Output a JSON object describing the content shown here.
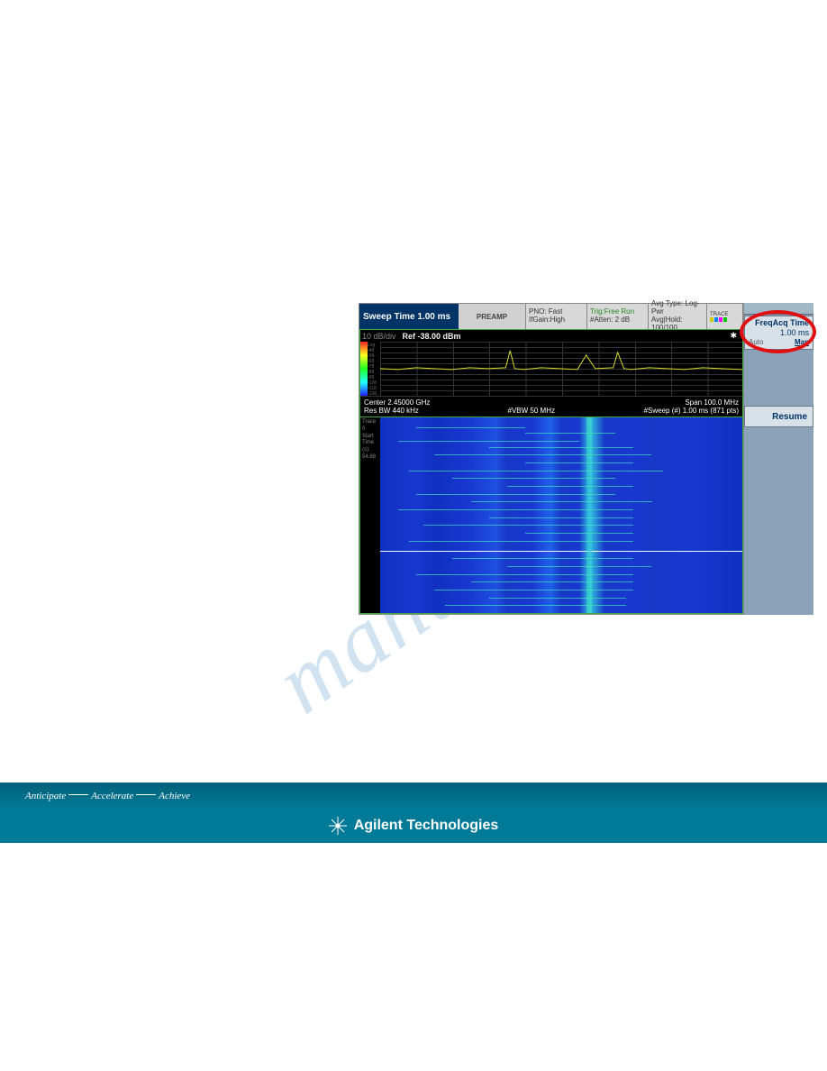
{
  "watermark": "manual",
  "instrument": {
    "title": "Sweep Time 1.00 ms",
    "preamp": "PREAMP",
    "pno_line1": "PNO: Fast",
    "pno_line2": "IfGain:High",
    "trig_line1": "Trig:Free Run",
    "trig_line2": "#Atten: 2 dB",
    "avg_line1": "Avg Type: Log-Pwr",
    "avg_line2": "Avg|Hold: 100/100",
    "trace_label": "TRACE",
    "ref_div": "10 dB/div",
    "ref_val": "Ref -38.00 dBm",
    "y_log": "Log",
    "center": "Center 2.45000 GHz",
    "span": "Span 100.0 MHz",
    "resbw": "Res BW 440 kHz",
    "vbw": "#VBW 50 MHz",
    "sweep": "#Sweep (#) 1.00 ms (871 pts)",
    "spec_trace": "Trace",
    "spec_num": "0",
    "spec_start": "Start",
    "spec_time": "Time",
    "spec_s": "(s):",
    "spec_val": "54.88"
  },
  "sidepanel": {
    "freqacq_title": "FreqAcq Time",
    "freqacq_val": "1.00 ms",
    "auto": "Auto",
    "man": "Man",
    "resume": "Resume"
  },
  "footer": {
    "t1": "Anticipate",
    "t2": "Accelerate",
    "t3": "Achieve",
    "brand": "Agilent Technologies"
  }
}
